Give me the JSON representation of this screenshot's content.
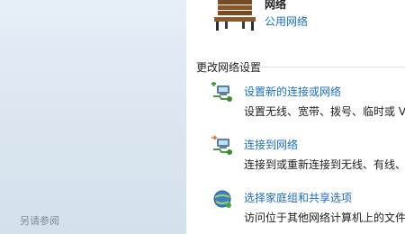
{
  "left_pane": {
    "see_also_label": "另请参阅"
  },
  "network": {
    "name": "网络",
    "type_link": "公用网络",
    "icon": "park-bench-icon"
  },
  "change_settings": {
    "section_title": "更改网络设置",
    "tasks": [
      {
        "icon": "new-connection-icon",
        "label": "设置新的连接或网络",
        "description": "设置无线、宽带、拨号、临时或 VPN"
      },
      {
        "icon": "connect-network-icon",
        "label": "连接到网络",
        "description": "连接到或重新连接到无线、有线、拨号"
      },
      {
        "icon": "homegroup-icon",
        "label": "选择家庭组和共享选项",
        "description": "访问位于其他网络计算机上的文件和"
      }
    ]
  }
}
